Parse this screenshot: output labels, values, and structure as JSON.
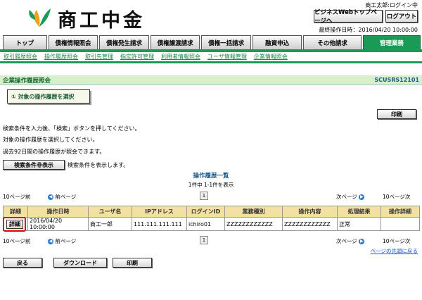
{
  "header": {
    "logo_text": "商工中金",
    "user_name": "商工太郎:ログイン中",
    "top_page_button": "ビジネスWebトップページへ",
    "logout_button": "ログアウト",
    "last_operation": "最終操作日時：2016/04/20 10:00:00"
  },
  "tabs": [
    {
      "label": "トップ"
    },
    {
      "label": "債権情報照会"
    },
    {
      "label": "債権発生請求"
    },
    {
      "label": "債権譲渡請求"
    },
    {
      "label": "債権一括請求"
    },
    {
      "label": "融資申込"
    },
    {
      "label": "その他請求"
    },
    {
      "label": "管理業務"
    }
  ],
  "subnav": [
    "取引履歴照会",
    "操作履歴照会",
    "取引先管理",
    "指定許可管理",
    "利用者情報照会",
    "ユーザ情報管理",
    "企業情報照会"
  ],
  "page": {
    "title": "企業操作履歴照会",
    "screen_code": "SCUSRS12101",
    "step": "① 対象の操作履歴を選択",
    "print_label": "印刷",
    "desc1": "検索条件を入力後、「検索」ボタンを押してください。",
    "desc2": "対象の操作履歴を選択してください。",
    "desc3": "過去92日間の操作履歴が照会できます。",
    "toggle_search_button": "検索条件非表示",
    "toggle_search_note": "検索条件を表示します。"
  },
  "list": {
    "title": "操作履歴一覧",
    "count": "1件中 1-1件を表示",
    "prev10": "10ページ前",
    "prev": "前ページ",
    "next": "次ページ",
    "next10": "10ページ次",
    "page": "1",
    "headers": [
      "詳細",
      "操作日時",
      "ユーザ名",
      "IPアドレス",
      "ログインID",
      "業務種別",
      "操作内容",
      "処理結果",
      "操作詳細"
    ],
    "rows": [
      {
        "detail": "詳細",
        "datetime": "2016/04/20 10:00:00",
        "user": "商工一郎",
        "ip": "111.111.111.111",
        "login_id": "ichiro01",
        "category": "ZZZZZZZZZZZZ",
        "operation": "ZZZZZZZZZZZZ",
        "result": "正常",
        "op_detail": ""
      }
    ],
    "page_top_link": "ページの先頭に戻る"
  },
  "footer": {
    "back": "戻る",
    "download": "ダウンロード",
    "print": "印刷"
  },
  "colors": {
    "brand_green": "#1a9a57",
    "table_header": "#f3e1a3",
    "highlight": "#e00000"
  }
}
